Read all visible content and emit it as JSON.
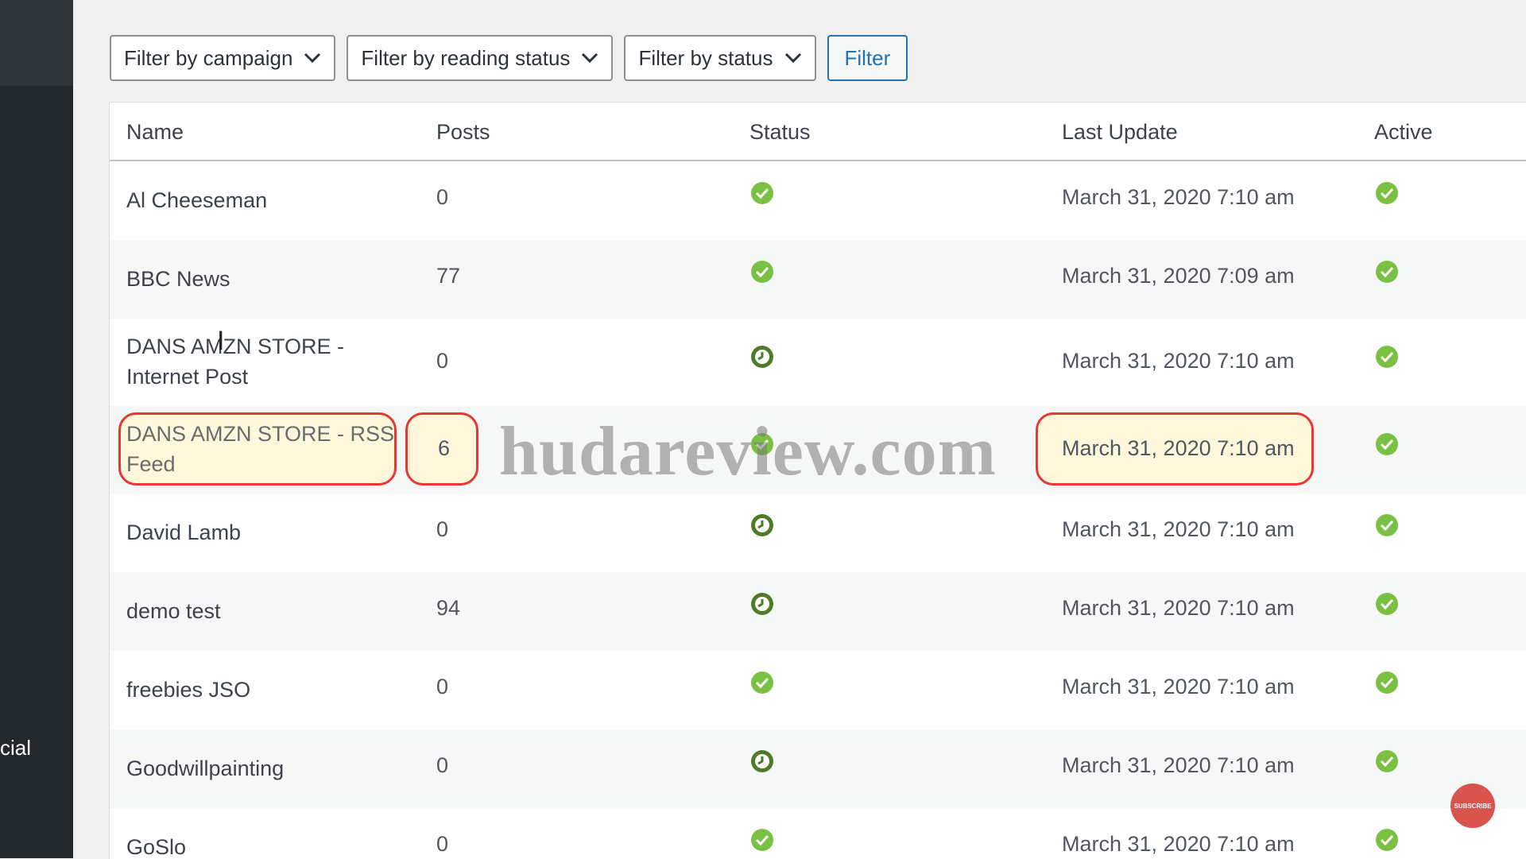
{
  "sidebar": {
    "partial_label": "cial"
  },
  "filters": {
    "campaign": "Filter by campaign",
    "reading_status": "Filter by reading status",
    "status": "Filter by status",
    "button": "Filter"
  },
  "table": {
    "headers": {
      "name": "Name",
      "posts": "Posts",
      "status": "Status",
      "last_update": "Last Update",
      "active": "Active"
    },
    "rows": [
      {
        "name": "Al Cheeseman",
        "posts": "0",
        "status_icon": "check-icon",
        "last_update": "March 31, 2020 7:10 am",
        "active_icon": "check-icon"
      },
      {
        "name": "BBC News",
        "posts": "77",
        "status_icon": "check-icon",
        "last_update": "March 31, 2020 7:09 am",
        "active_icon": "check-icon"
      },
      {
        "name_line1": "DANS AMZN STORE -",
        "name_line2": "Internet Post",
        "posts": "0",
        "status_icon": "clock-icon",
        "last_update": "March 31, 2020 7:10 am",
        "active_icon": "check-icon"
      },
      {
        "name_line1": "DANS AMZN STORE - RSS",
        "name_line2": "Feed",
        "posts": "6",
        "status_icon": "check-icon",
        "last_update": "March 31, 2020 7:10 am",
        "active_icon": "check-icon",
        "highlighted": true
      },
      {
        "name": "David Lamb",
        "posts": "0",
        "status_icon": "clock-icon",
        "last_update": "March 31, 2020 7:10 am",
        "active_icon": "check-icon"
      },
      {
        "name": "demo test",
        "posts": "94",
        "status_icon": "clock-icon",
        "last_update": "March 31, 2020 7:10 am",
        "active_icon": "check-icon"
      },
      {
        "name": "freebies JSO",
        "posts": "0",
        "status_icon": "check-icon",
        "last_update": "March 31, 2020 7:10 am",
        "active_icon": "check-icon"
      },
      {
        "name": "Goodwillpainting",
        "posts": "0",
        "status_icon": "clock-icon",
        "last_update": "March 31, 2020 7:10 am",
        "active_icon": "check-icon"
      },
      {
        "name": "GoSlo",
        "posts": "0",
        "status_icon": "check-icon",
        "last_update": "March 31, 2020 7:10 am",
        "active_icon": "check-icon"
      }
    ]
  },
  "watermark": "hudareview.com",
  "subscribe_badge": "SUBSCRIBE",
  "colors": {
    "ok_green": "#7ac143",
    "clock_green": "#4f7a28",
    "highlight_red": "#e53935",
    "highlight_fill": "#fff7dc",
    "link_blue": "#2271b1"
  }
}
